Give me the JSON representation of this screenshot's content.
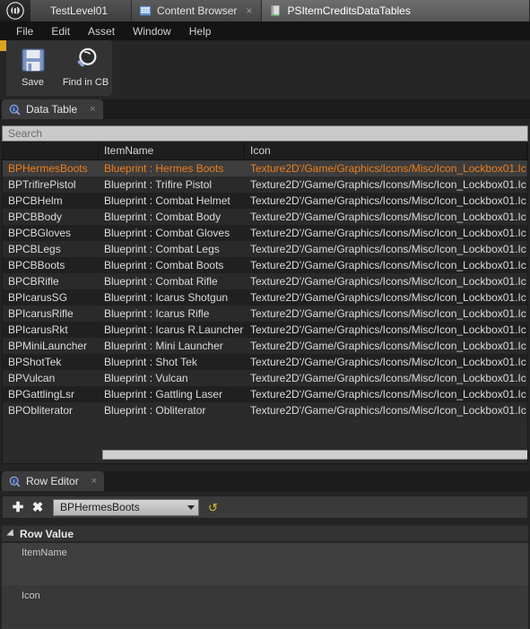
{
  "window": {
    "logo_icon": "unreal-logo-icon",
    "tabs": [
      {
        "label": "TestLevel01",
        "icon": "",
        "closable": false,
        "active": false
      },
      {
        "label": "Content Browser",
        "icon": "content-browser-icon",
        "closable": true,
        "active": false
      },
      {
        "label": "PSItemCreditsDataTables",
        "icon": "data-table-asset-icon",
        "closable": false,
        "active": true
      }
    ],
    "close_glyph": "×"
  },
  "menubar": {
    "items": [
      "File",
      "Edit",
      "Asset",
      "Window",
      "Help"
    ]
  },
  "toolbar": {
    "buttons": [
      {
        "label": "Save",
        "icon": "save-icon"
      },
      {
        "label": "Find in CB",
        "icon": "magnifier-icon"
      }
    ]
  },
  "data_table_panel": {
    "tab_label": "Data Table",
    "tab_icon": "info-magnifier-icon",
    "tab_close_glyph": "×",
    "search": {
      "placeholder": "Search",
      "value": ""
    },
    "columns": [
      "",
      "ItemName",
      "Icon"
    ],
    "selected_row": "BPHermesBoots",
    "rows": [
      {
        "name": "BPHermesBoots",
        "item_name": "Blueprint : Hermes Boots",
        "icon": "Texture2D'/Game/Graphics/Icons/Misc/Icon_Lockbox01.Ic"
      },
      {
        "name": "BPTrifirePistol",
        "item_name": "Blueprint : Trifire Pistol",
        "icon": "Texture2D'/Game/Graphics/Icons/Misc/Icon_Lockbox01.Ic"
      },
      {
        "name": "BPCBHelm",
        "item_name": "Blueprint : Combat Helmet",
        "icon": "Texture2D'/Game/Graphics/Icons/Misc/Icon_Lockbox01.Ic"
      },
      {
        "name": "BPCBBody",
        "item_name": "Blueprint : Combat Body",
        "icon": "Texture2D'/Game/Graphics/Icons/Misc/Icon_Lockbox01.Ic"
      },
      {
        "name": "BPCBGloves",
        "item_name": "Blueprint : Combat Gloves",
        "icon": "Texture2D'/Game/Graphics/Icons/Misc/Icon_Lockbox01.Ic"
      },
      {
        "name": "BPCBLegs",
        "item_name": "Blueprint : Combat Legs",
        "icon": "Texture2D'/Game/Graphics/Icons/Misc/Icon_Lockbox01.Ic"
      },
      {
        "name": "BPCBBoots",
        "item_name": "Blueprint : Combat Boots",
        "icon": "Texture2D'/Game/Graphics/Icons/Misc/Icon_Lockbox01.Ic"
      },
      {
        "name": "BPCBRifle",
        "item_name": "Blueprint : Combat Rifle",
        "icon": "Texture2D'/Game/Graphics/Icons/Misc/Icon_Lockbox01.Ic"
      },
      {
        "name": "BPIcarusSG",
        "item_name": "Blueprint : Icarus Shotgun",
        "icon": "Texture2D'/Game/Graphics/Icons/Misc/Icon_Lockbox01.Ic"
      },
      {
        "name": "BPIcarusRifle",
        "item_name": "Blueprint : Icarus Rifle",
        "icon": "Texture2D'/Game/Graphics/Icons/Misc/Icon_Lockbox01.Ic"
      },
      {
        "name": "BPIcarusRkt",
        "item_name": "Blueprint : Icarus R.Launcher",
        "icon": "Texture2D'/Game/Graphics/Icons/Misc/Icon_Lockbox01.Ic"
      },
      {
        "name": "BPMiniLauncher",
        "item_name": "Blueprint : Mini Launcher",
        "icon": "Texture2D'/Game/Graphics/Icons/Misc/Icon_Lockbox01.Ic"
      },
      {
        "name": "BPShotTek",
        "item_name": "Blueprint : Shot Tek",
        "icon": "Texture2D'/Game/Graphics/Icons/Misc/Icon_Lockbox01.Ic"
      },
      {
        "name": "BPVulcan",
        "item_name": "Blueprint : Vulcan",
        "icon": "Texture2D'/Game/Graphics/Icons/Misc/Icon_Lockbox01.Ic"
      },
      {
        "name": "BPGattlingLsr",
        "item_name": "Blueprint : Gattling Laser",
        "icon": "Texture2D'/Game/Graphics/Icons/Misc/Icon_Lockbox01.Ic"
      },
      {
        "name": "BPObliterator",
        "item_name": "Blueprint : Obliterator",
        "icon": "Texture2D'/Game/Graphics/Icons/Misc/Icon_Lockbox01.Ic"
      }
    ]
  },
  "row_editor": {
    "tab_label": "Row Editor",
    "tab_icon": "info-magnifier-icon",
    "tab_close_glyph": "×",
    "add_glyph": "✚",
    "remove_glyph": "✖",
    "reset_glyph": "↺",
    "selected_row": "BPHermesBoots",
    "section_label": "Row Value",
    "properties": [
      {
        "label": "ItemName",
        "value": ""
      },
      {
        "label": "Icon",
        "value": ""
      }
    ]
  },
  "colors": {
    "accent_orange": "#ef7d1a",
    "toolbar_accent": "#d9a520",
    "reset_yellow": "#e3c01f",
    "panel_bg": "#2b2b2b",
    "row_selected": "#3d3d3d"
  }
}
